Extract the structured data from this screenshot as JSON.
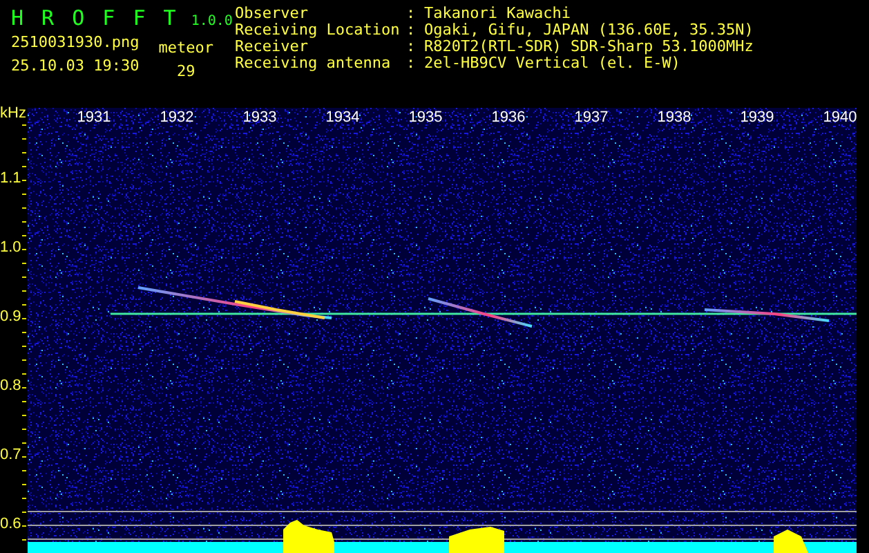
{
  "app": {
    "name": "H R O F F T",
    "version": "1.0.0",
    "file": "2510031930.png",
    "datetime": "25.10.03 19:30",
    "meteor_label": "meteor",
    "meteor_count": "29"
  },
  "info": [
    {
      "label": "Observer",
      "separator": ":",
      "value": "Takanori Kawachi"
    },
    {
      "label": "Receiving Location",
      "separator": ":",
      "value": "Ogaki, Gifu, JAPAN (136.60E, 35.35N)"
    },
    {
      "label": "Receiver",
      "separator": ":",
      "value": "R820T2(RTL-SDR) SDR-Sharp 53.1000MHz"
    },
    {
      "label": "Receiving antenna",
      "separator": ":",
      "value": "2el-HB9CV Vertical (el. E-W)"
    }
  ],
  "spectrogram": {
    "y_unit": "kHz",
    "y_ticks": [
      "1.1",
      "1.0",
      "0.9",
      "0.8",
      "0.7",
      "0.6"
    ],
    "x_ticks": [
      "1931",
      "1932",
      "1933",
      "1934",
      "1935",
      "1936",
      "1937",
      "1938",
      "1939",
      "1940"
    ]
  }
}
